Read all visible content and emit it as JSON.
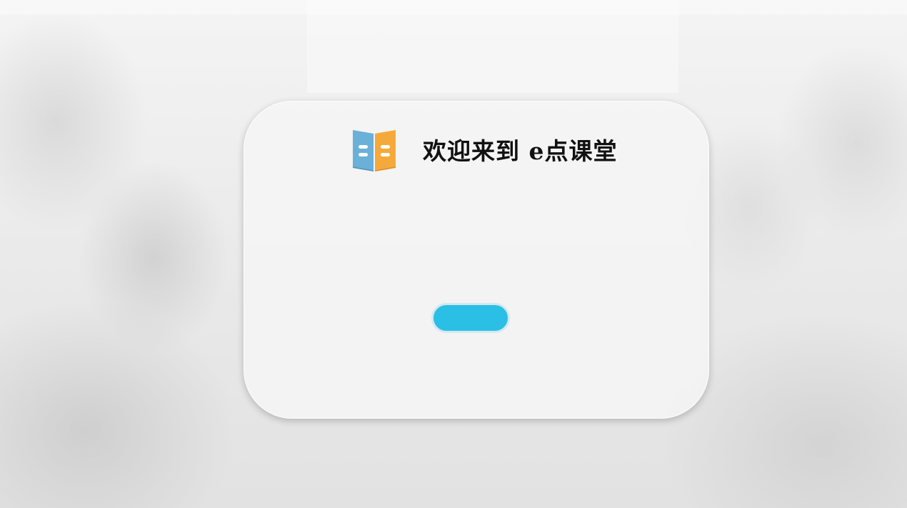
{
  "header": {
    "logo_icon": "open-book-icon",
    "title": "欢迎来到 e点课堂"
  },
  "main": {
    "primary_button_label": ""
  },
  "colors": {
    "accent": "#2bbfe6",
    "book_left": "#6ab0d8",
    "book_right": "#f6a93b"
  }
}
